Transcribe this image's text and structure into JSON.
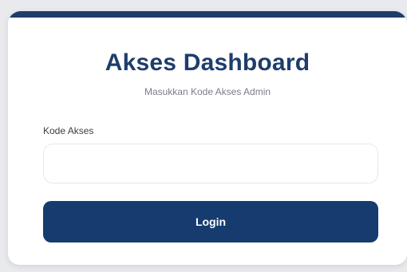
{
  "header": {
    "title": "Akses Dashboard",
    "subtitle": "Masukkan Kode Akses Admin"
  },
  "form": {
    "access_code_label": "Kode Akses",
    "access_code_value": "",
    "access_code_placeholder": "",
    "login_label": "Login"
  },
  "colors": {
    "brand": "#1e3d6b",
    "button": "#153b6f",
    "background": "#e9eaed",
    "card": "#ffffff"
  }
}
